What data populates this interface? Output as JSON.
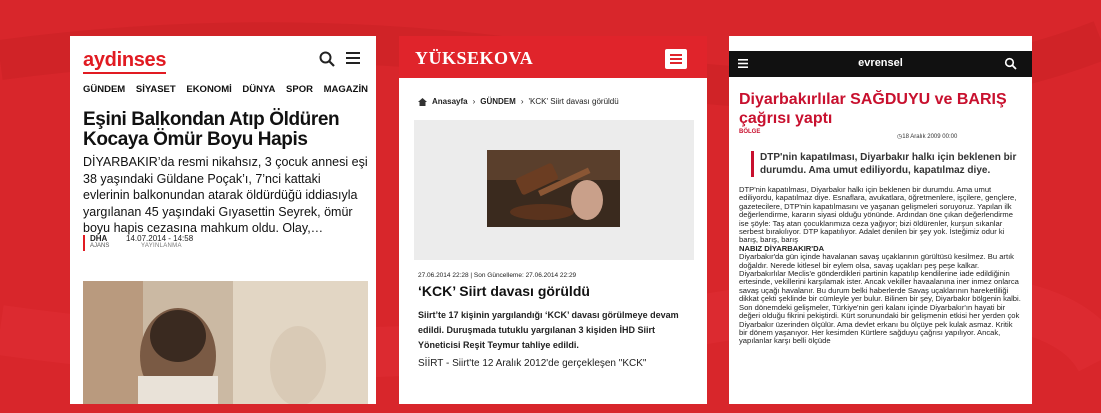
{
  "colors": {
    "background": "#d8262b",
    "accent": "#e11b22",
    "evrensel_red": "#c8102e"
  },
  "card1": {
    "logo": "aydinses",
    "icons": [
      "search-icon",
      "menu-icon"
    ],
    "nav": [
      "GÜNDEM",
      "SİYASET",
      "EKONOMİ",
      "DÜNYA",
      "SPOR",
      "MAGAZİN"
    ],
    "title": "Eşini Balkondan Atıp Öldüren Kocaya Ömür Boyu Hapis",
    "lead": "DİYARBAKIR’da resmi nikahsız, 3 çocuk annesi eşi 38 yaşındaki Güldane Poçak’ı, 7’nci kattaki evlerinin balkonundan atarak öldürdüğü iddiasıyla yargılanan 45 yaşındaki Gıyasettin Seyrek, ömür boyu hapis cezasına mahkum oldu. Olay,…",
    "source": "DHA",
    "source_sub": "AJANS",
    "date": "14.07.2014 - 14:58",
    "published": "YAYINLANMA"
  },
  "card2": {
    "logo": "YÜKSEKOVA",
    "breadcrumb": [
      "Anasayfa",
      "GÜNDEM",
      "'KCK' Siirt davası görüldü"
    ],
    "date_line": "27.06.2014 22:28 | Son Güncelleme: 27.06.2014 22:29",
    "title": "‘KCK’ Siirt davası görüldü",
    "summary": "Siirt’te 17 kişinin yargılandığı ‘KCK’ davası görülmeye devam edildi. Duruşmada tutuklu yargılanan 3 kişiden İHD Siirt Yöneticisi Reşit Teymur tahliye edildi.",
    "body": "SİİRT - Siirt'te 12 Aralık 2012'de gerçekleşen \"KCK\""
  },
  "card3": {
    "logo": "evrensel",
    "title": "Diyarbakırlılar SAĞDUYU ve BARIŞ çağrısı yaptı",
    "category": "BÖLGE",
    "date": "◷18 Aralık 2009 00:00",
    "quote": "DTP'nin kapatılması, Diyarbakır halkı için beklenen bir durumdu. Ama umut ediliyordu, kapatılmaz diye.",
    "body1": "DTP'nin kapatılması, Diyarbakır halkı için beklenen bir durumdu. Ama umut ediliyordu, kapatılmaz diye. Esnaflara, avukatlara, öğretmenlere, işçilere, gençlere, gazetecilere, DTP'nin kapatılmasını ve yaşanan gelişmeleri soruyoruz. Yapılan ilk değerlendirme, kararın siyasi olduğu yönünde. Ardından öne çıkan değerlendirme ise şöyle: Taş atan çocuklarımıza ceza yağıyor; bizi öldürenler, kurşun sıkanlar serbest bırakılıyor. DTP kapatılıyor. Adalet denilen bir şey yok. İsteğimiz odur ki barış, barış, barış",
    "subhead": "NABIZ DİYARBAKIR'DA",
    "body2": "Diyarbakır'da gün içinde havalanan savaş uçaklarının gürültüsü kesilmez. Bu artık doğaldır. Nerede kitlesel bir eylem olsa, savaş uçakları peş peşe kalkar. Diyarbakırlılar Meclis'e gönderdikleri partinin kapatılıp kendilerine iade edildiğinin ertesinde, vekillerini karşılamak ister. Ancak vekiller havaalanına iner inmez onlarca savaş uçağı havalanır. Bu durum belki haberlerde Savaş uçaklarının hareketliliği dikkat çekti şeklinde bir cümleyle yer bulur. Bilinen bir şey, Diyarbakır bölgenin kalbi. Son dönemdeki gelişmeler, Türkiye'nin geri kalanı içinde Diyarbakır'ın hayati bir değeri olduğu fikrini pekiştirdi. Kürt sorunundaki bir gelişmenin etkisi her yerden çok Diyarbakır üzerinden ölçülür. Ama devlet erkanı bu ölçüye pek kulak asmaz. Kritik bir dönem yaşanıyor. Her kesimden Kürtlere sağduyu çağrısı yapılıyor. Ancak, yapılanlar karşı belli ölçüde"
  }
}
